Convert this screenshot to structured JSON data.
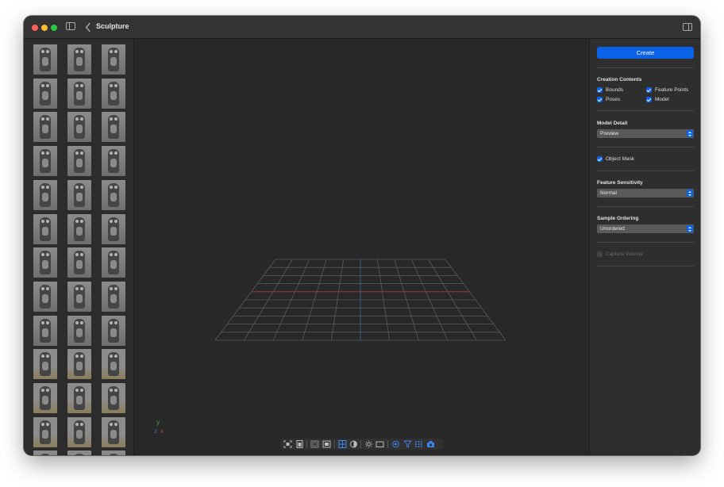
{
  "window": {
    "title": "Sculpture"
  },
  "toolbar_icons": [
    "sidebar-toggle-icon",
    "back-chevron-icon",
    "inspector-toggle-icon"
  ],
  "thumbnails": {
    "rows": 13,
    "columns": 3
  },
  "viewport": {
    "axis_labels": {
      "y": "y",
      "z": "z",
      "x": "x"
    },
    "grid_colors": {
      "lines": "#5a5a5a",
      "x_axis": "#a0443a",
      "z_axis": "#3f6ea8"
    }
  },
  "bottom_tools": [
    "frame-icon",
    "portrait-icon",
    "rect-outline-icon",
    "image-icon",
    "grid-icon",
    "contrast-icon",
    "sun-icon",
    "rectangle-icon",
    "target-icon",
    "funnel-icon",
    "points-icon",
    "camera-stack-icon"
  ],
  "inspector": {
    "create_label": "Create",
    "creation_contents": {
      "title": "Creation Contents",
      "bounds": "Bounds",
      "feature_points": "Feature Points",
      "poses": "Poses",
      "model": "Model"
    },
    "model_detail": {
      "title": "Model Detail",
      "value": "Preview"
    },
    "object_mask": "Object Mask",
    "feature_sensitivity": {
      "title": "Feature Sensitivity",
      "value": "Normal"
    },
    "sample_ordering": {
      "title": "Sample Ordering",
      "value": "Unordered"
    },
    "capture_volume": "Capture Volume"
  },
  "colors": {
    "accent": "#0a62e8",
    "window_bg": "#262626",
    "panel_bg": "#2e2e2e"
  }
}
